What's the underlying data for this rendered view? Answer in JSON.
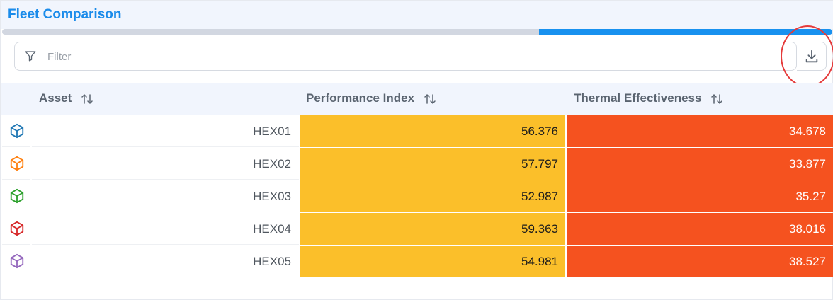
{
  "header": {
    "title": "Fleet Comparison"
  },
  "progress": {
    "fraction": 0.353,
    "fill_color": "#1891ef",
    "track_color": "#d2d7e1"
  },
  "filter": {
    "placeholder": "Filter",
    "value": "",
    "icon": "filter-funnel-icon"
  },
  "toolbar": {
    "download_icon": "download-icon",
    "highlight_color": "#e53a3a"
  },
  "table": {
    "columns": [
      {
        "label": "Asset",
        "sort_icon": "sort-arrows-icon"
      },
      {
        "label": "Performance Index",
        "sort_icon": "sort-arrows-icon"
      },
      {
        "label": "Thermal Effectiveness",
        "sort_icon": "sort-arrows-icon"
      }
    ],
    "rows": [
      {
        "icon": "cube-icon",
        "icon_color": "#1f77b4",
        "asset": "HEX01",
        "performance_index": "56.376",
        "thermal_effectiveness": "34.678"
      },
      {
        "icon": "cube-icon",
        "icon_color": "#ff7f0e",
        "asset": "HEX02",
        "performance_index": "57.797",
        "thermal_effectiveness": "33.877"
      },
      {
        "icon": "cube-icon",
        "icon_color": "#2ca02c",
        "asset": "HEX03",
        "performance_index": "52.987",
        "thermal_effectiveness": "35.27"
      },
      {
        "icon": "cube-icon",
        "icon_color": "#d62728",
        "asset": "HEX04",
        "performance_index": "59.363",
        "thermal_effectiveness": "38.016"
      },
      {
        "icon": "cube-icon",
        "icon_color": "#9467bd",
        "asset": "HEX05",
        "performance_index": "54.981",
        "thermal_effectiveness": "38.527"
      }
    ],
    "cell_colors": {
      "performance_index": "#fbbf2a",
      "thermal_effectiveness": "#f5521f"
    }
  }
}
